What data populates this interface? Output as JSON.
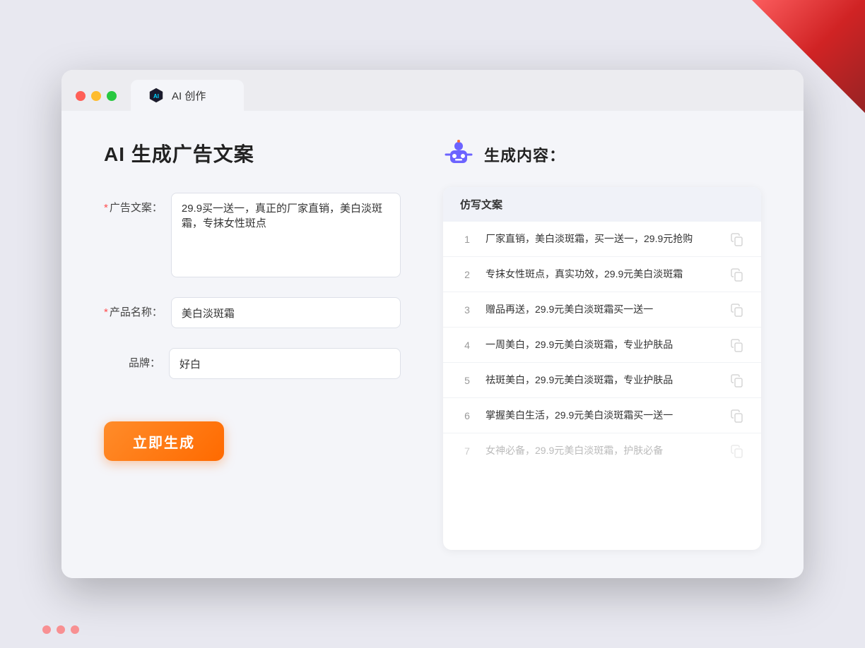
{
  "browser": {
    "tab_label": "AI 创作"
  },
  "left_panel": {
    "title": "AI 生成广告文案",
    "fields": [
      {
        "id": "ad_copy",
        "label": "广告文案：",
        "required": true,
        "type": "textarea",
        "value": "29.9买一送一，真正的厂家直销，美白淡斑霜，专抹女性斑点"
      },
      {
        "id": "product_name",
        "label": "产品名称：",
        "required": true,
        "type": "input",
        "value": "美白淡斑霜"
      },
      {
        "id": "brand",
        "label": "品牌：",
        "required": false,
        "type": "input",
        "value": "好白"
      }
    ],
    "submit_button": "立即生成"
  },
  "right_panel": {
    "title": "生成内容：",
    "table_header": "仿写文案",
    "results": [
      {
        "num": "1",
        "text": "厂家直销，美白淡斑霜，买一送一，29.9元抢购",
        "dimmed": false
      },
      {
        "num": "2",
        "text": "专抹女性斑点，真实功效，29.9元美白淡斑霜",
        "dimmed": false
      },
      {
        "num": "3",
        "text": "赠品再送，29.9元美白淡斑霜买一送一",
        "dimmed": false
      },
      {
        "num": "4",
        "text": "一周美白，29.9元美白淡斑霜，专业护肤品",
        "dimmed": false
      },
      {
        "num": "5",
        "text": "祛斑美白，29.9元美白淡斑霜，专业护肤品",
        "dimmed": false
      },
      {
        "num": "6",
        "text": "掌握美白生活，29.9元美白淡斑霜买一送一",
        "dimmed": false
      },
      {
        "num": "7",
        "text": "女神必备，29.9元美白淡斑霜，护肤必备",
        "dimmed": true
      }
    ]
  }
}
